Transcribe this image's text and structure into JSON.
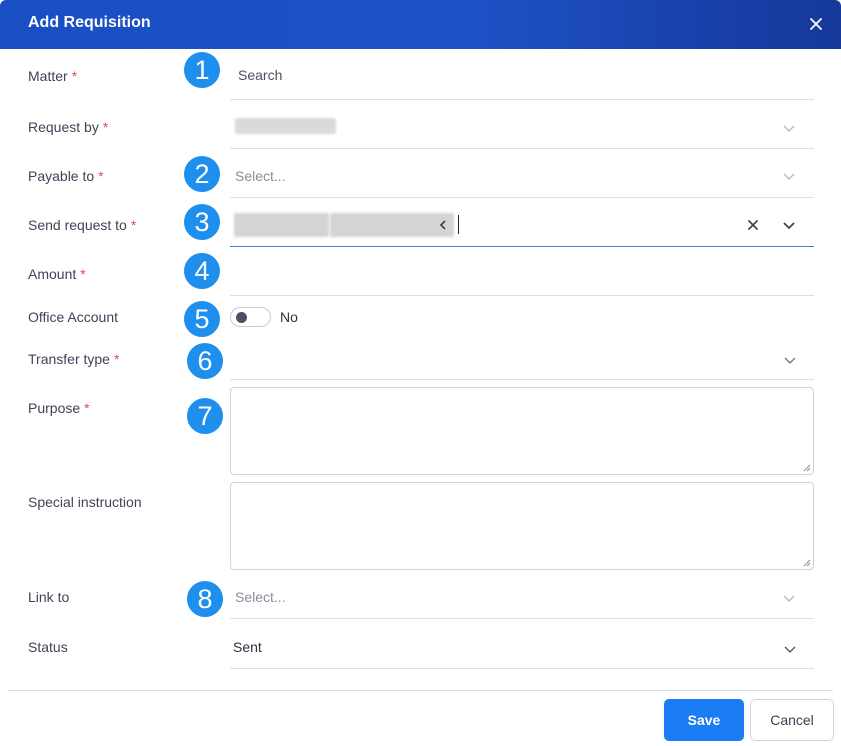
{
  "dialog": {
    "title": "Add Requisition",
    "close_icon": "close-icon"
  },
  "badges": [
    "1",
    "2",
    "3",
    "4",
    "5",
    "6",
    "7",
    "8"
  ],
  "fields": {
    "matter": {
      "label": "Matter",
      "required": "*",
      "placeholder": "Search"
    },
    "request_by": {
      "label": "Request by",
      "required": "*"
    },
    "payable_to": {
      "label": "Payable to",
      "required": "*",
      "placeholder": "Select..."
    },
    "send_request_to": {
      "label": "Send request to",
      "required": "*"
    },
    "amount": {
      "label": "Amount",
      "required": "*",
      "value": ""
    },
    "office_account": {
      "label": "Office Account",
      "toggle_value": "No"
    },
    "transfer_type": {
      "label": "Transfer type",
      "required": "*",
      "value": ""
    },
    "purpose": {
      "label": "Purpose",
      "required": "*",
      "value": ""
    },
    "special_instruction": {
      "label": "Special instruction",
      "value": ""
    },
    "link_to": {
      "label": "Link to",
      "placeholder": "Select..."
    },
    "status": {
      "label": "Status",
      "value": "Sent"
    }
  },
  "footer": {
    "save_label": "Save",
    "cancel_label": "Cancel"
  },
  "colors": {
    "header": "#1e52c7",
    "badge": "#1f8fee",
    "primary_button": "#1a7df3",
    "required": "#e24a4a"
  }
}
